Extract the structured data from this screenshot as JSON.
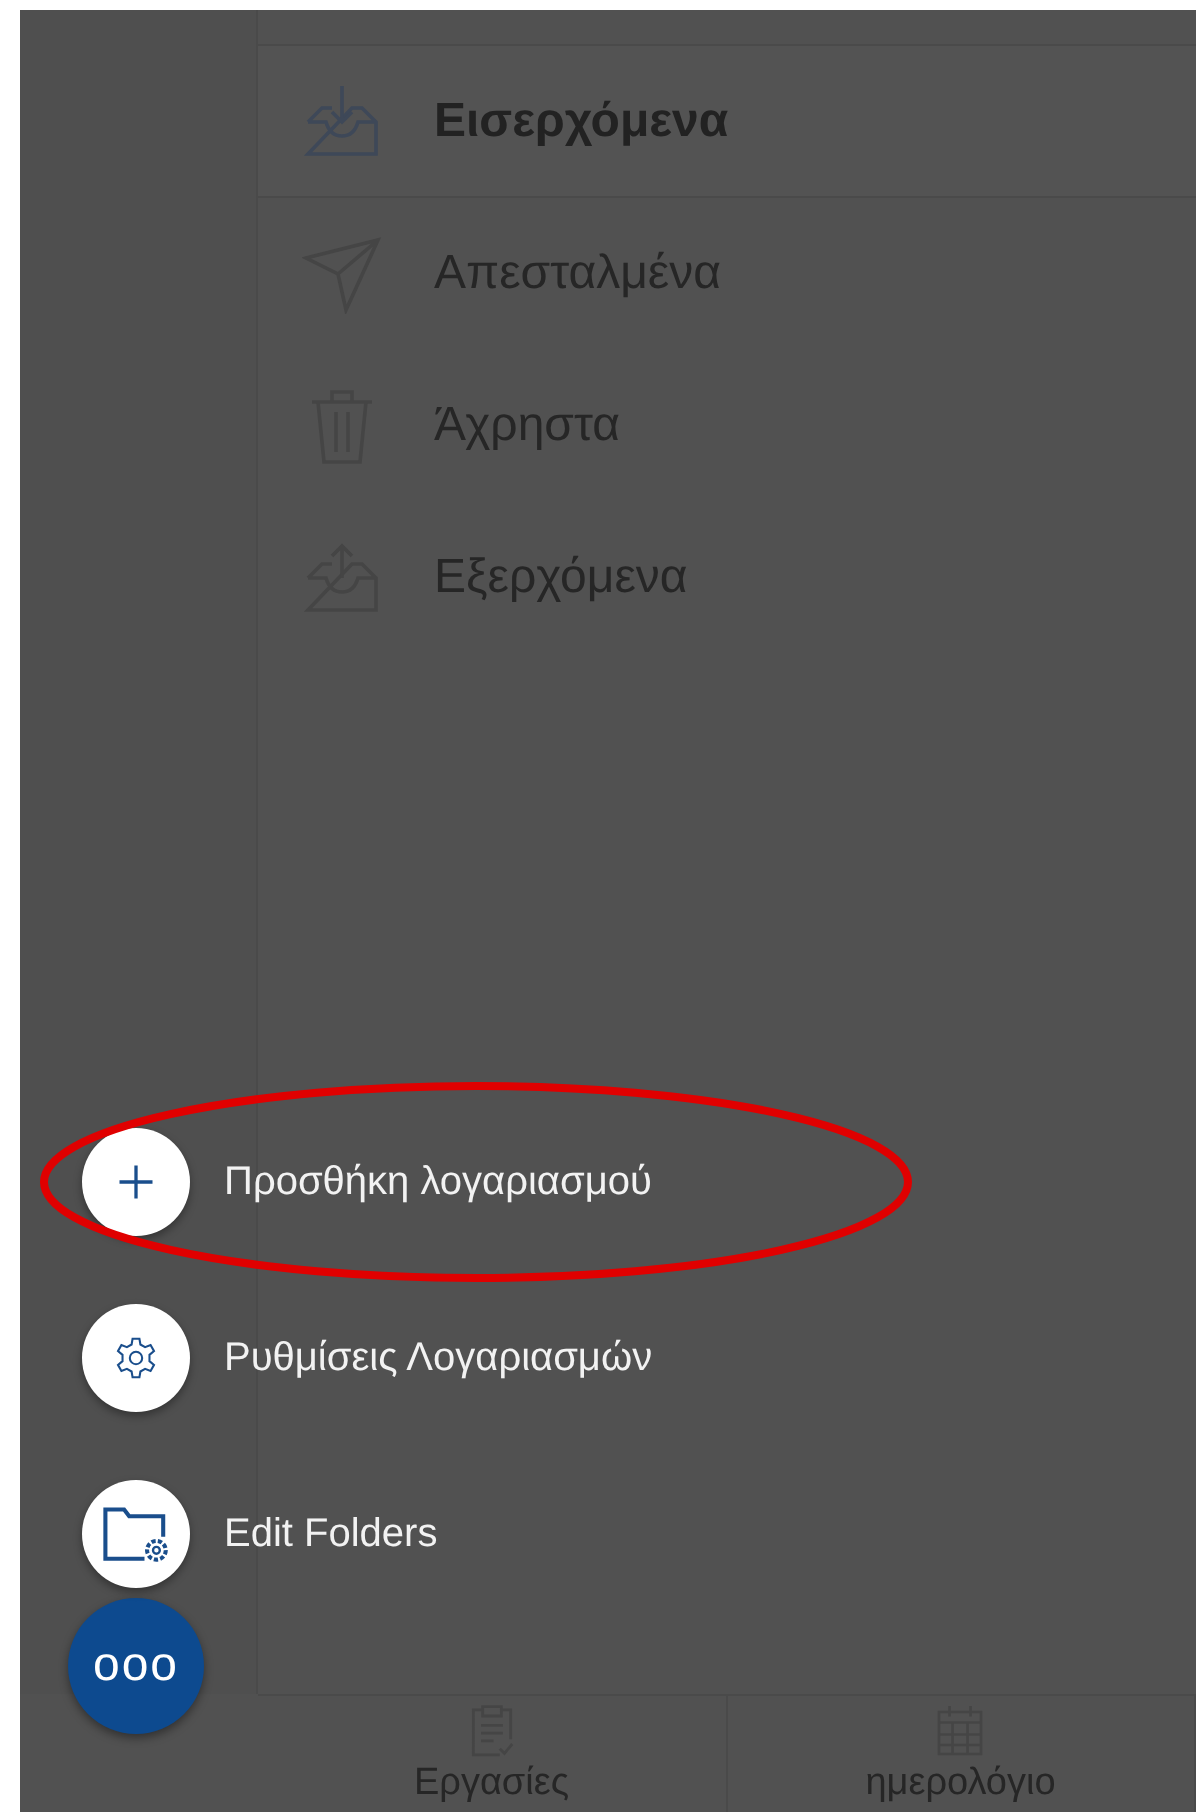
{
  "folders": [
    {
      "label": "Εισερχόμενα",
      "selected": true
    },
    {
      "label": "Απεσταλμένα",
      "selected": false
    },
    {
      "label": "Άχρηστα",
      "selected": false
    },
    {
      "label": "Εξερχόμενα",
      "selected": false
    }
  ],
  "actions": [
    {
      "label": "Προσθήκη λογαριασμού",
      "highlighted": true
    },
    {
      "label": "Ρυθμίσεις Λογαριασμών",
      "highlighted": false
    },
    {
      "label": "Edit Folders",
      "highlighted": false
    }
  ],
  "fab": {
    "label": "ooo"
  },
  "tabs": [
    {
      "label": "Εργασίες"
    },
    {
      "label": "ημερολόγιο"
    }
  ]
}
